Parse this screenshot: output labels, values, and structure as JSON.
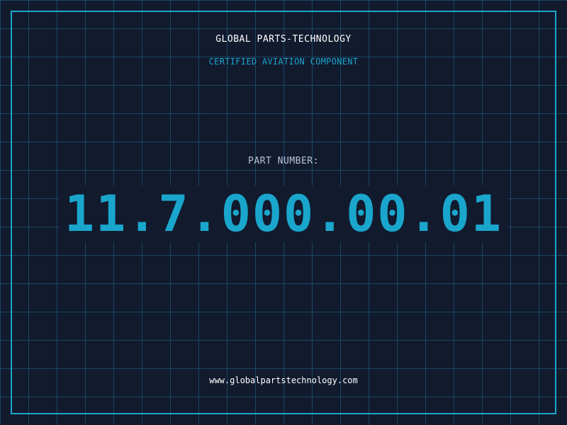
{
  "header": {
    "company": "GLOBAL PARTS-TECHNOLOGY",
    "tagline": "CERTIFIED AVIATION COMPONENT"
  },
  "part": {
    "label": "PART NUMBER:",
    "number": "11.7.000.00.01"
  },
  "footer": {
    "website": "www.globalpartstechnology.com"
  },
  "colors": {
    "background": "#121a2e",
    "accent": "#1aa6cc",
    "grid": "#1e6e8c",
    "text": "#ffffff",
    "label": "#b8c4d8"
  }
}
